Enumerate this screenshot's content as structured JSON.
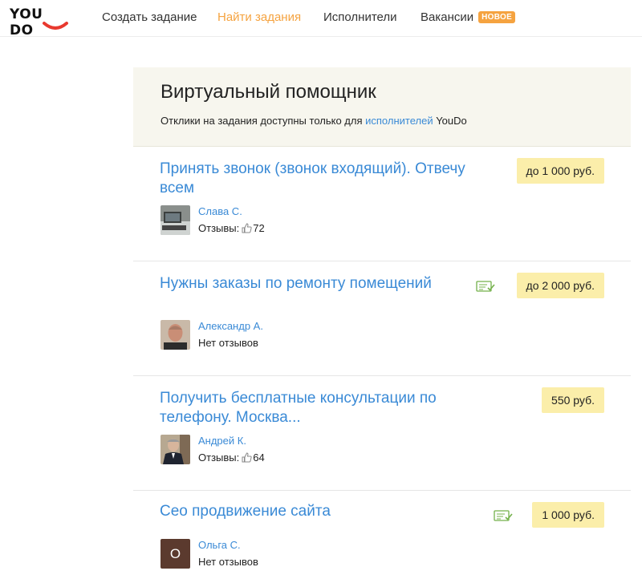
{
  "brand": {
    "logo_text": "YOU DO",
    "accent": "#f5a340",
    "link_color": "#3a8ad6"
  },
  "nav": {
    "items": [
      {
        "label": "Создать задание",
        "active": false
      },
      {
        "label": "Найти задания",
        "active": true
      },
      {
        "label": "Исполнители",
        "active": false
      },
      {
        "label": "Вакансии",
        "active": false
      }
    ],
    "badge": "НОВОЕ"
  },
  "category": {
    "title": "Виртуальный помощник",
    "notice_before": "Отклики на задания доступны только для ",
    "notice_link": "исполнителей",
    "notice_after": " YouDo"
  },
  "tasks": [
    {
      "title": "Принять звонок (звонок входящий). Отвечу всем",
      "price": "до 1 000 руб.",
      "has_doc_icon": false,
      "author": "Слава С.",
      "reviews_label": "Отзывы:",
      "reviews_count": "72"
    },
    {
      "title": "Нужны заказы по ремонту помещений",
      "price": "до 2 000 руб.",
      "has_doc_icon": true,
      "author": "Александр А.",
      "reviews_label": "Нет отзывов",
      "reviews_count": ""
    },
    {
      "title": "Получить бесплатные консультации по телефону. Москва...",
      "price": "550 руб.",
      "has_doc_icon": false,
      "author": "Андрей К.",
      "reviews_label": "Отзывы:",
      "reviews_count": "64"
    },
    {
      "title": "Сео продвижение сайта",
      "price": "1 000 руб.",
      "has_doc_icon": true,
      "author": "Ольга С.",
      "avatar_letter": "О",
      "reviews_label": "Нет отзывов",
      "reviews_count": ""
    }
  ],
  "icons": {
    "doc": "document-check-icon",
    "thumb": "thumbs-up-icon"
  }
}
